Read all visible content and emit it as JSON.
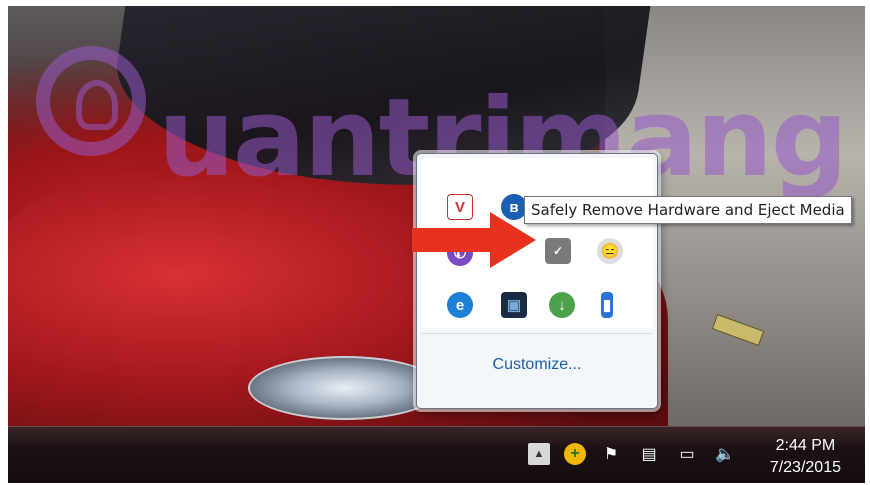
{
  "watermark": {
    "text": "uantrimang"
  },
  "tray_flyout": {
    "icons": [
      {
        "name": "avg-icon",
        "glyph": "V"
      },
      {
        "name": "bluetooth-icon",
        "glyph": "ʙ"
      },
      {
        "name": "viber-icon",
        "glyph": "✆"
      },
      {
        "name": "green-app-icon",
        "glyph": ""
      },
      {
        "name": "usb-safely-remove-icon",
        "glyph": "✓"
      },
      {
        "name": "emoticon-icon",
        "glyph": "😑"
      },
      {
        "name": "internet-explorer-icon",
        "glyph": "e"
      },
      {
        "name": "network-monitor-icon",
        "glyph": "▣"
      },
      {
        "name": "idm-download-icon",
        "glyph": "↓"
      },
      {
        "name": "usb-device-icon",
        "glyph": "▮"
      }
    ],
    "customize_label": "Customize..."
  },
  "tooltip": {
    "text": "Safely Remove Hardware and Eject Media"
  },
  "taskbar": {
    "tray_icons": [
      {
        "name": "show-hidden-icons-icon",
        "glyph": "▲"
      },
      {
        "name": "green-plus-icon",
        "glyph": "+"
      },
      {
        "name": "action-center-flag-icon",
        "glyph": "⚑"
      },
      {
        "name": "usb-tray-icon",
        "glyph": "▤"
      },
      {
        "name": "network-icon",
        "glyph": "▭"
      },
      {
        "name": "volume-icon",
        "glyph": "🔈"
      }
    ],
    "clock": {
      "time": "2:44 PM",
      "date": "7/23/2015"
    }
  },
  "colors": {
    "accent": "#1f5fa8",
    "arrow": "#e8321e",
    "tooltip_border": "#767676"
  }
}
